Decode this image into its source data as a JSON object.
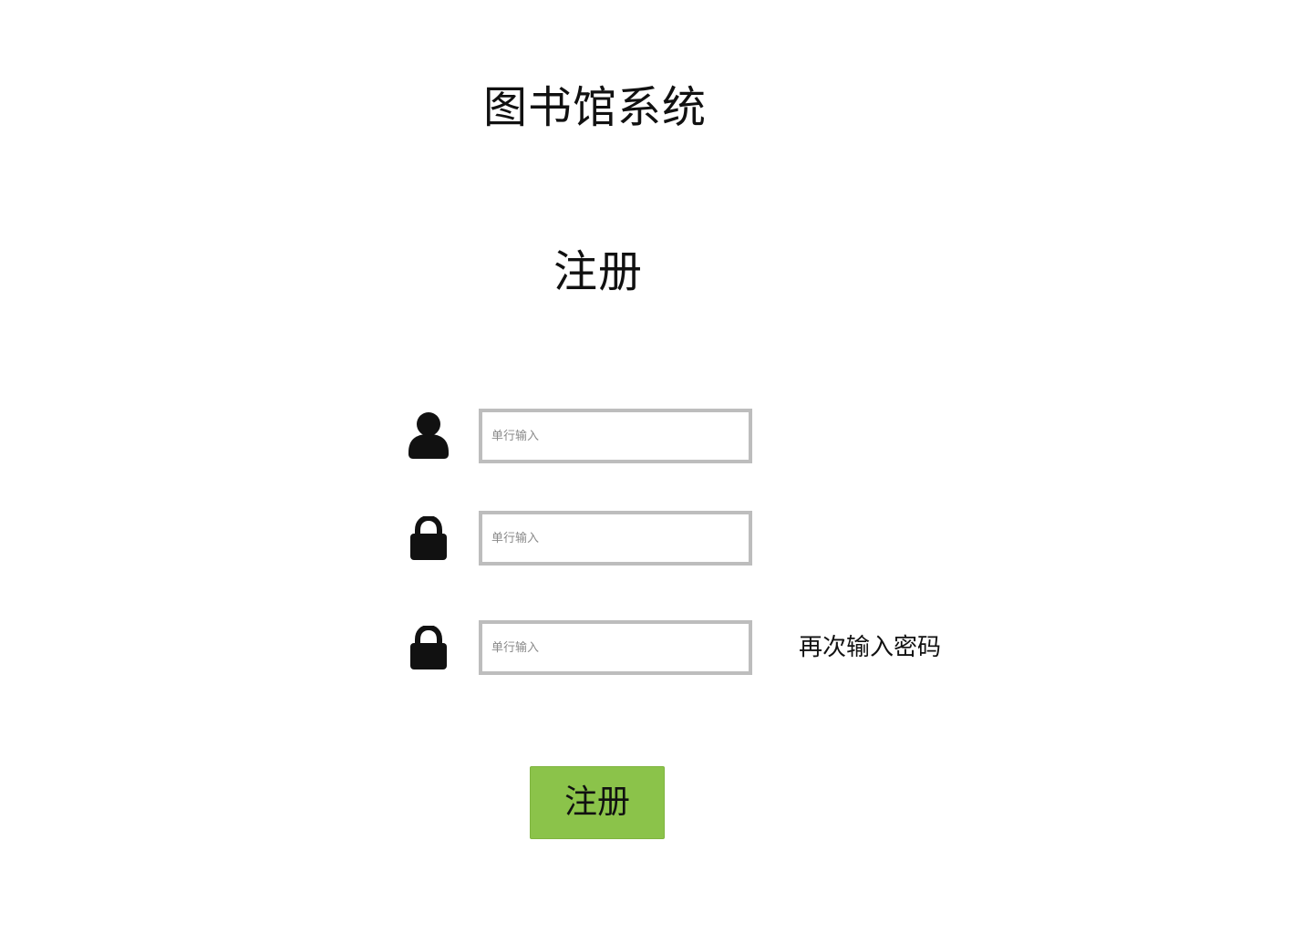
{
  "app": {
    "title": "图书馆系统"
  },
  "form": {
    "heading": "注册",
    "fields": [
      {
        "icon": "user-icon",
        "placeholder": "单行输入",
        "value": ""
      },
      {
        "icon": "lock-icon",
        "placeholder": "单行输入",
        "value": ""
      },
      {
        "icon": "lock-icon",
        "placeholder": "单行输入",
        "value": "",
        "hint": "再次输入密码"
      }
    ],
    "submit_label": "注册"
  },
  "colors": {
    "button_bg": "#8bc34a",
    "input_border": "#bdbdbd",
    "text": "#111111"
  }
}
